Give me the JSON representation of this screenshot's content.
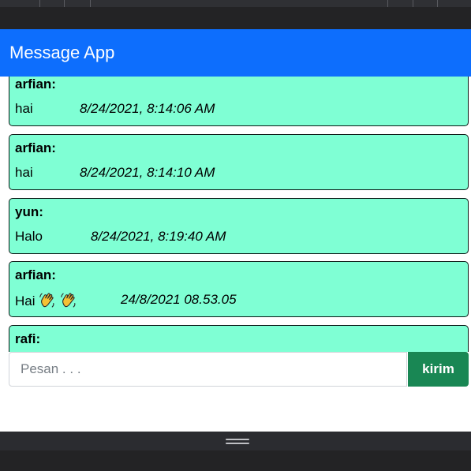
{
  "app": {
    "title": "Message App"
  },
  "colors": {
    "navbar": "#0d6efd",
    "message_card": "#7fffd4",
    "send_button": "#198754"
  },
  "messages": [
    {
      "sender": "arfian:",
      "text": "hai",
      "time": "8/24/2021, 8:14:06 AM"
    },
    {
      "sender": "arfian:",
      "text": "hai",
      "time": "8/24/2021, 8:14:10 AM"
    },
    {
      "sender": "yun:",
      "text": "Halo",
      "time": "8/24/2021, 8:19:40 AM"
    },
    {
      "sender": "arfian:",
      "text": "Hai",
      "emoji": [
        "waving-hand-icon",
        "waving-hand-icon"
      ],
      "time": "24/8/2021 08.53.05"
    },
    {
      "sender": "rafi:",
      "text": "",
      "time": ""
    }
  ],
  "composer": {
    "placeholder": "Pesan . . .",
    "value": "",
    "send_label": "kirim"
  }
}
